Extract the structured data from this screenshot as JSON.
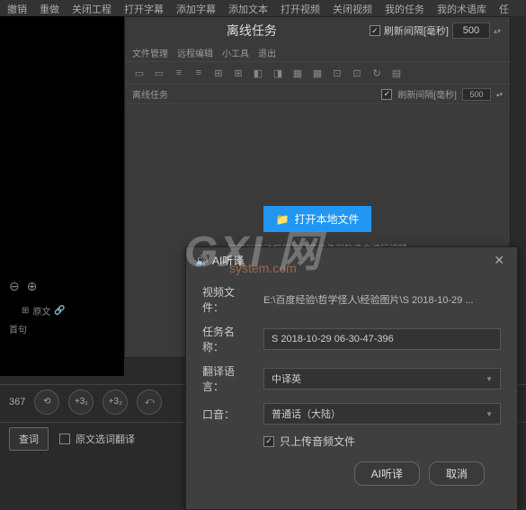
{
  "top_menu": [
    "撤销",
    "重做",
    "关闭工程",
    "打开字幕",
    "添加字幕",
    "添加文本",
    "打开视频",
    "关闭视频",
    "我的任务",
    "我的术语库",
    "任"
  ],
  "window1": {
    "title": "离线任务",
    "refresh_label": "刷新间隔[毫秒]",
    "refresh_value": "500",
    "sub_tabs": [
      "文件管理",
      "远程编辑",
      "小工具",
      "退出"
    ],
    "inner_title": "离线任务",
    "inner_refresh": "刷新间隔[毫秒]",
    "inner_refresh_value": "500",
    "open_btn": "打开本地文件",
    "hint": "您可以拖动视频和字幕文件到软件中进行编辑"
  },
  "left": {
    "text1": "原文",
    "text2": "首句"
  },
  "bottom": {
    "time": "367",
    "btns": [
      "⟲",
      "+3₁",
      "+3₂",
      "⤺"
    ],
    "query_btn": "查词",
    "translate_checkbox": "原文选词翻译"
  },
  "modal": {
    "title": "AI听译",
    "rows": {
      "video_file_label": "视频文件：",
      "video_file_value": "E:\\百度经验\\哲学怪人\\经验图片\\S 2018-10-29 ...",
      "task_name_label": "任务名称：",
      "task_name_value": "S 2018-10-29 06-30-47-396",
      "lang_label": "翻译语言：",
      "lang_value": "中译英",
      "accent_label": "口音：",
      "accent_value": "普通话（大陆）"
    },
    "checkbox_label": "只上传音频文件",
    "ok_btn": "AI听译",
    "cancel_btn": "取消"
  },
  "watermark": "GXI 网",
  "watermark_sub": "system.com"
}
